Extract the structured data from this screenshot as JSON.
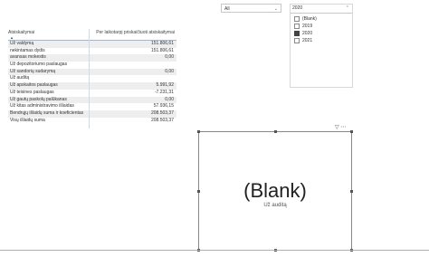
{
  "table": {
    "col1": "Atsiskaitymai",
    "col2": "Per laikotarpį priskaičiuoti atsiskaitymai",
    "rows": [
      {
        "label": "Už valdymą",
        "value": "151.806,61"
      },
      {
        "label": "nekintamas dydis",
        "value": "151.806,61"
      },
      {
        "label": "avansas mokestis",
        "value": "0,00"
      },
      {
        "label": "Už depozitoriumo paslaugas",
        "value": ""
      },
      {
        "label": "Už sandorių sudarymą",
        "value": "0,00"
      },
      {
        "label": "Už auditą",
        "value": ""
      },
      {
        "label": "Už apskaitos paslaugas",
        "value": "5.991,92"
      },
      {
        "label": "Už teisines paslaugas",
        "value": "-7.231,31"
      },
      {
        "label": "Už gautų paskolų palūkanas",
        "value": "0,00"
      },
      {
        "label": "Už kitas administravimo išlaidas",
        "value": "57.936,15"
      },
      {
        "label": "Bendrųjų išlaidų suma ir koeficientas",
        "value": "208.503,37"
      },
      {
        "label": "Visų išlaidų suma",
        "value": "208.503,37"
      }
    ]
  },
  "dropdown": {
    "value": "All"
  },
  "slicer": {
    "selected": "2020",
    "options": [
      {
        "label": "(Blank)",
        "checked": false
      },
      {
        "label": "2019",
        "checked": false
      },
      {
        "label": "2020",
        "checked": true
      },
      {
        "label": "2021",
        "checked": false
      }
    ]
  },
  "card": {
    "value": "(Blank)",
    "label": "Už auditą"
  }
}
